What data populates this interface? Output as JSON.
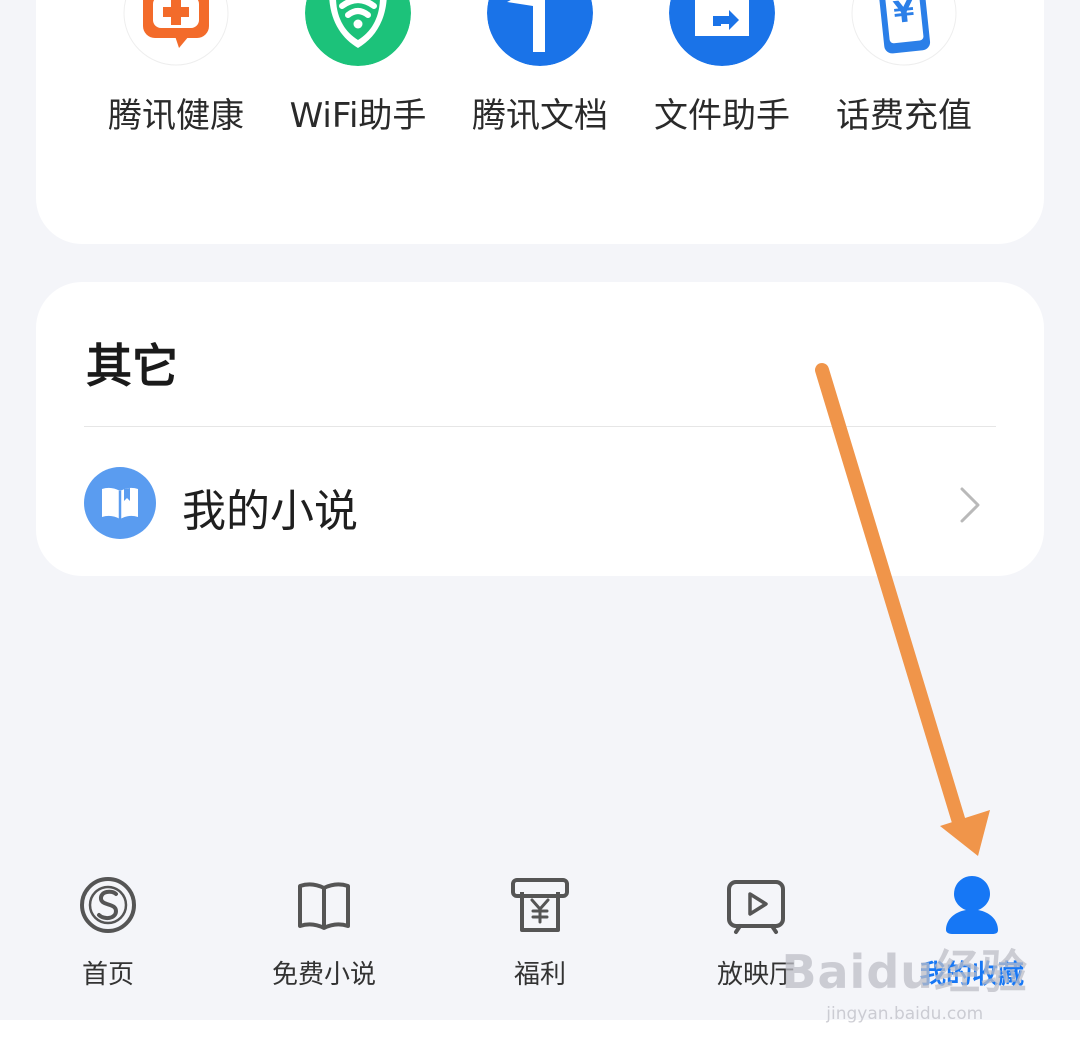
{
  "apps": [
    {
      "label": "腾讯健康",
      "icon": "health-cross-icon",
      "color": "#f36b2a"
    },
    {
      "label": "WiFi助手",
      "icon": "wifi-shield-icon",
      "color": "#1cc27a"
    },
    {
      "label": "腾讯文档",
      "icon": "docs-arrow-icon",
      "color": "#1a73e8"
    },
    {
      "label": "文件助手",
      "icon": "folder-share-icon",
      "color": "#1a73e8"
    },
    {
      "label": "话费充值",
      "icon": "phone-yuan-icon",
      "color": "#2b7fe8"
    }
  ],
  "other": {
    "title": "其它",
    "items": [
      {
        "label": "我的小说",
        "icon": "book-icon",
        "color": "#5a9cf0"
      }
    ]
  },
  "tabbar": {
    "tabs": [
      {
        "label": "首页",
        "icon": "sogou-logo-icon",
        "active": false
      },
      {
        "label": "免费小说",
        "icon": "open-book-icon",
        "active": false
      },
      {
        "label": "福利",
        "icon": "yuan-receipt-icon",
        "active": false
      },
      {
        "label": "放映厅",
        "icon": "play-tv-icon",
        "active": false
      },
      {
        "label": "我的收藏",
        "icon": "user-avatar-icon",
        "active": true
      }
    ],
    "active_color": "#1677f5"
  },
  "watermark": {
    "logo": "Baidu经验",
    "url": "jingyan.baidu.com"
  },
  "annotation_arrow_color": "#f0954a"
}
